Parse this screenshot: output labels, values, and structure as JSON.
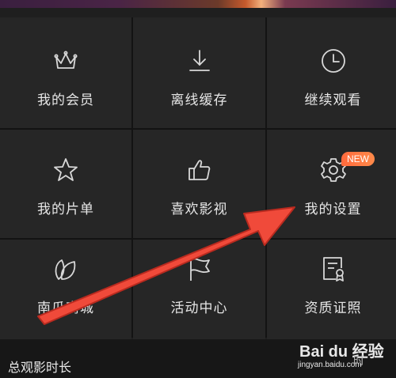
{
  "menu": {
    "items": [
      {
        "label": "我的会员",
        "icon": "crown-icon"
      },
      {
        "label": "离线缓存",
        "icon": "download-icon"
      },
      {
        "label": "继续观看",
        "icon": "clock-icon"
      },
      {
        "label": "我的片单",
        "icon": "star-icon"
      },
      {
        "label": "喜欢影视",
        "icon": "thumbs-up-icon"
      },
      {
        "label": "我的设置",
        "icon": "gear-icon",
        "badge": "NEW"
      },
      {
        "label": "南瓜商城",
        "icon": "leaf-icon"
      },
      {
        "label": "活动中心",
        "icon": "flag-icon"
      },
      {
        "label": "资质证照",
        "icon": "certificate-icon"
      }
    ]
  },
  "bottom": {
    "text": "总观影时长"
  },
  "watermark": {
    "brand": "Bai du 经验",
    "url": "jingyan.baidu.com",
    "time": "时"
  },
  "colors": {
    "background": "#262626",
    "accent": "#ff6a3d",
    "arrow": "#f04a3a"
  }
}
